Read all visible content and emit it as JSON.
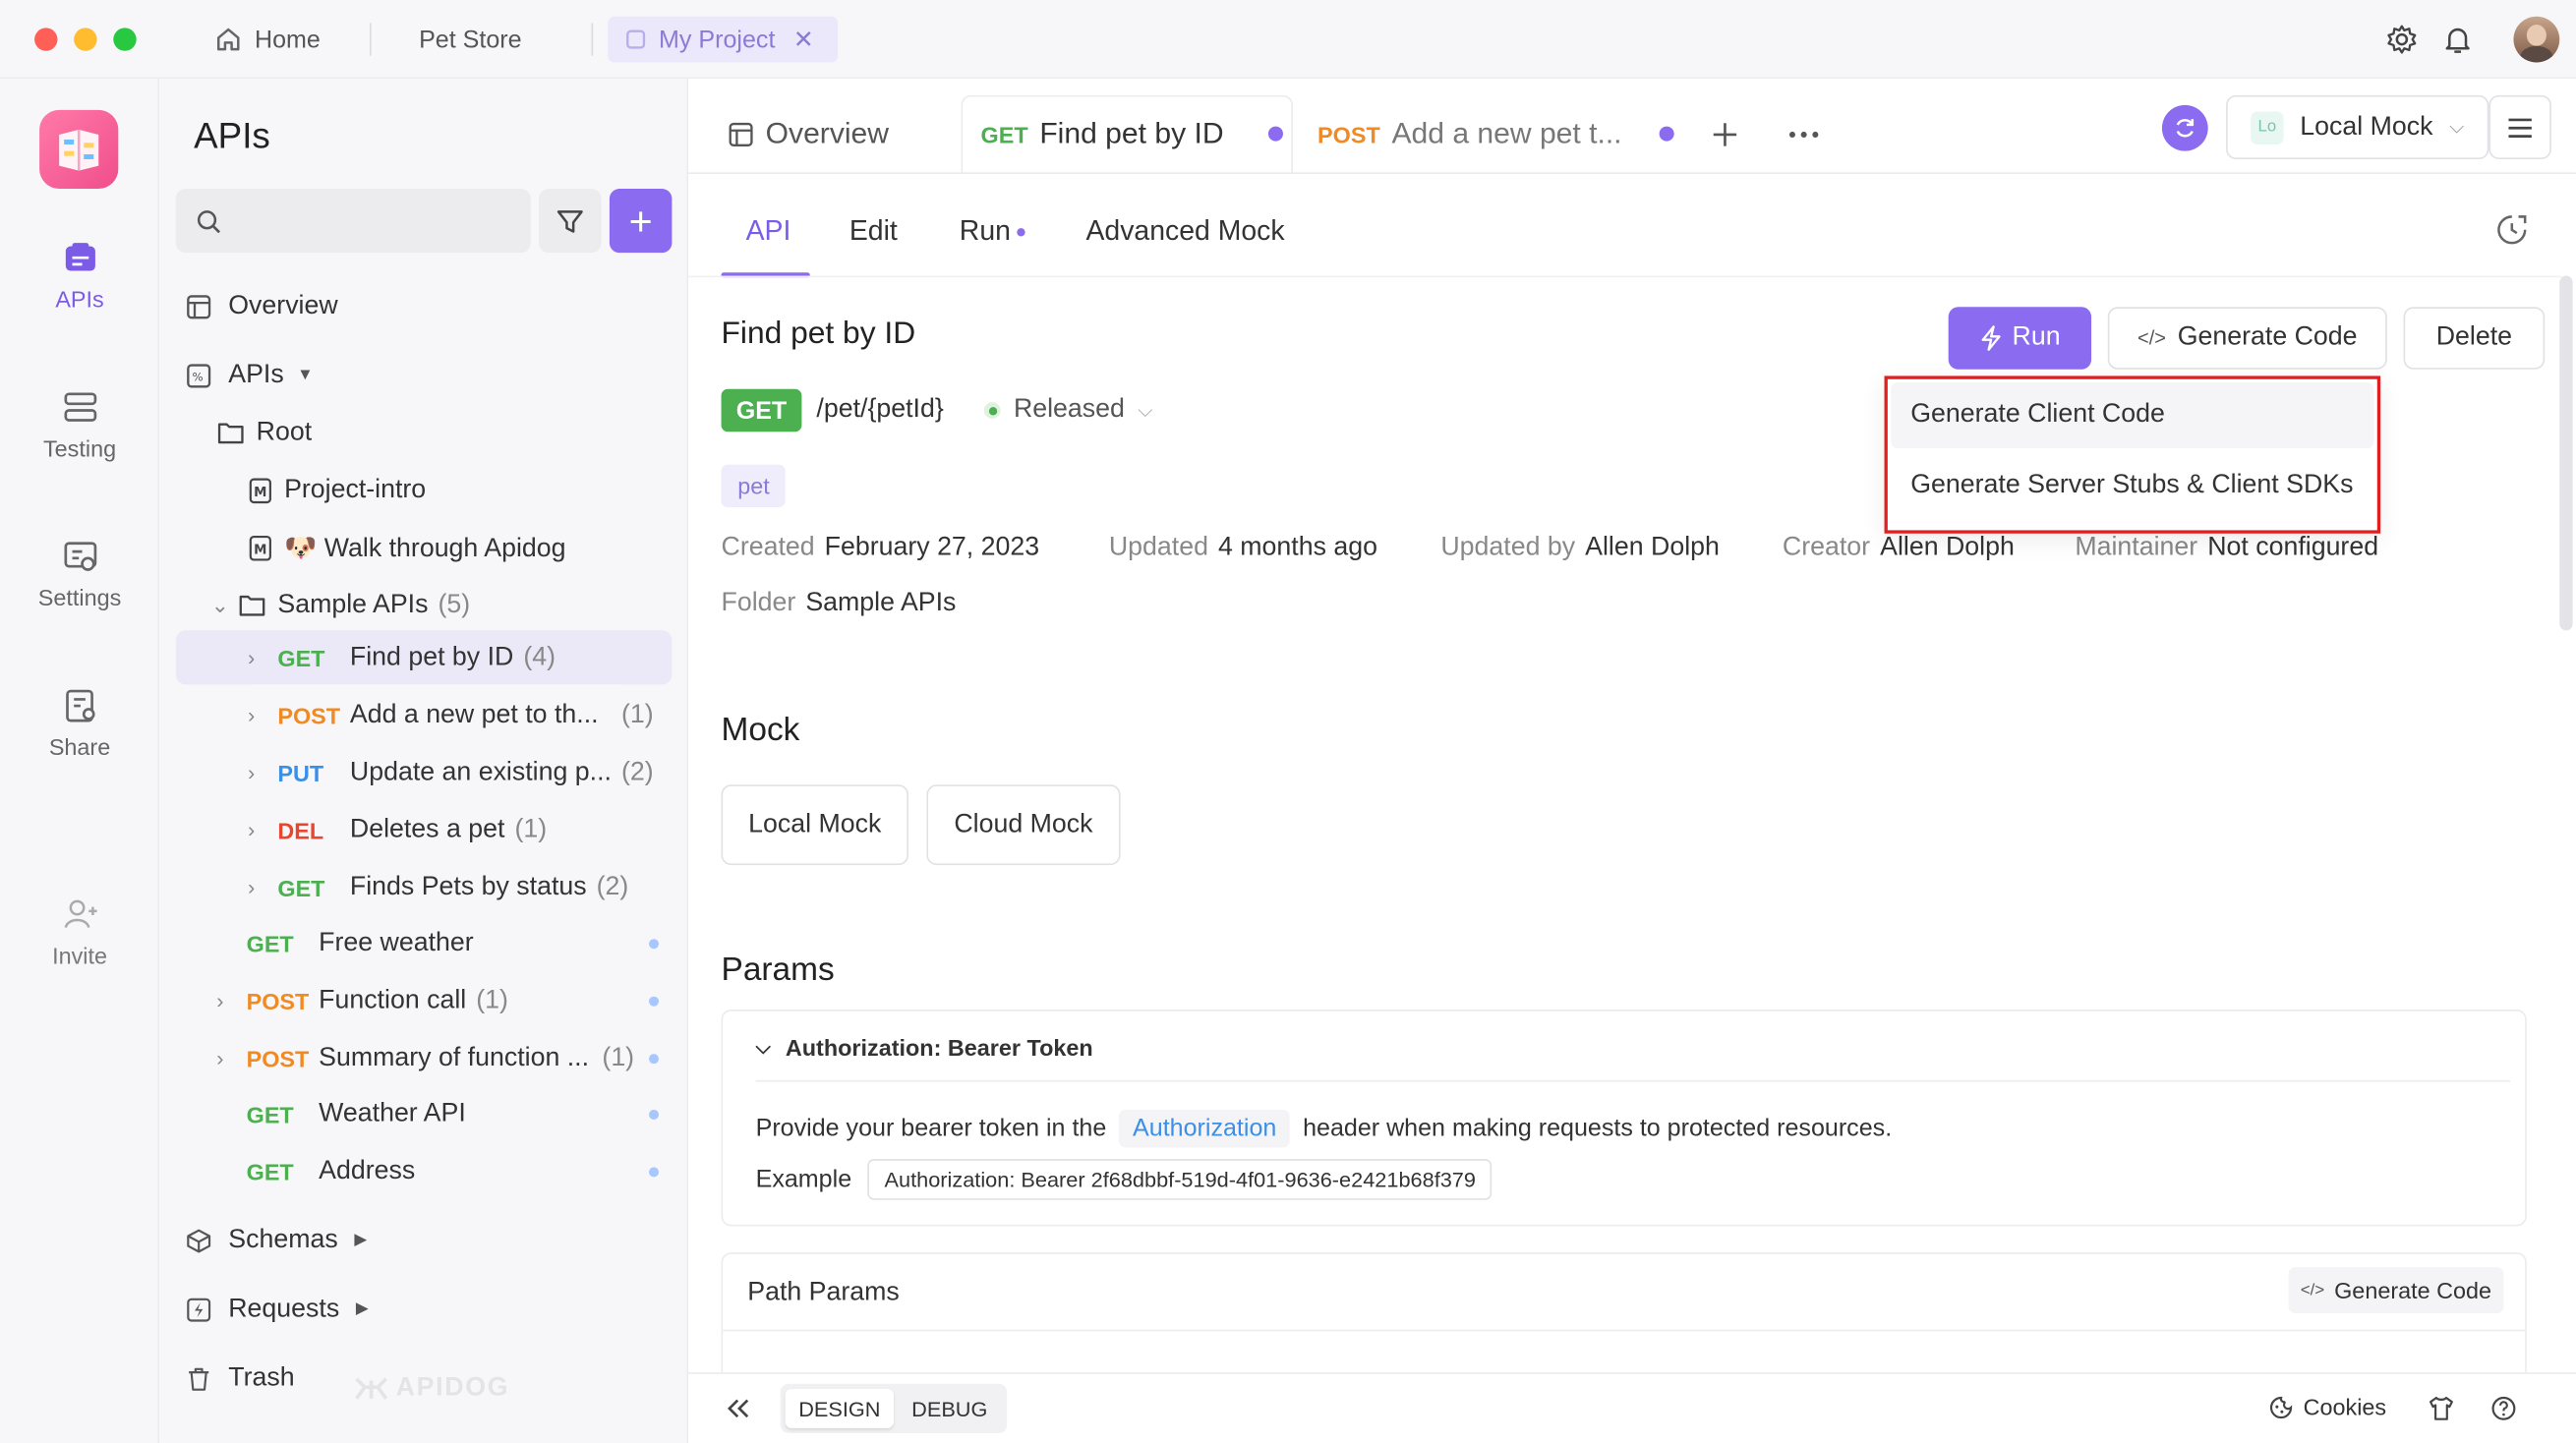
{
  "window": {
    "tabs": [
      {
        "label": "Home"
      },
      {
        "label": "Pet Store"
      },
      {
        "label": "My Project"
      }
    ]
  },
  "rail": {
    "items": [
      {
        "label": "APIs"
      },
      {
        "label": "Testing"
      },
      {
        "label": "Settings"
      },
      {
        "label": "Share"
      },
      {
        "label": "Invite"
      }
    ]
  },
  "sidebar": {
    "title": "APIs",
    "search_placeholder": "",
    "overview": "Overview",
    "apis": "APIs",
    "root": "Root",
    "docs": [
      "Project-intro",
      "🐶 Walk through Apidog"
    ],
    "folder": {
      "name": "Sample APIs",
      "count": "(5)"
    },
    "endpoints": [
      {
        "method": "GET",
        "name": "Find pet by ID",
        "count": "(4)"
      },
      {
        "method": "POST",
        "name": "Add a new pet to th...",
        "count": "(1)"
      },
      {
        "method": "PUT",
        "name": "Update an existing p...",
        "count": "(2)"
      },
      {
        "method": "DEL",
        "name": "Deletes a pet",
        "count": "(1)"
      },
      {
        "method": "GET",
        "name": "Finds Pets by status",
        "count": "(2)"
      }
    ],
    "root_endpoints": [
      {
        "method": "GET",
        "name": "Free weather",
        "count": ""
      },
      {
        "method": "POST",
        "name": "Function call",
        "count": "(1)"
      },
      {
        "method": "POST",
        "name": "Summary of function ...",
        "count": "(1)"
      },
      {
        "method": "GET",
        "name": "Weather API",
        "count": ""
      },
      {
        "method": "GET",
        "name": "Address",
        "count": ""
      }
    ],
    "schemas": "Schemas",
    "requests": "Requests",
    "trash": "Trash",
    "watermark": "APIDOG"
  },
  "doc_tabs": {
    "overview": "Overview",
    "tab1": {
      "method": "GET",
      "title": "Find pet by ID"
    },
    "tab2": {
      "method": "POST",
      "title": "Add a new pet t..."
    }
  },
  "env": {
    "badge": "Lo",
    "label": "Local Mock"
  },
  "sub_tabs": [
    "API",
    "Edit",
    "Run",
    "Advanced Mock"
  ],
  "endpoint": {
    "title": "Find pet by ID",
    "method": "GET",
    "path": "/pet/{petId}",
    "status": "Released",
    "tag": "pet",
    "created_label": "Created",
    "created": "February 27, 2023",
    "updated_label": "Updated",
    "updated": "4 months ago",
    "updated_by_label": "Updated by",
    "updated_by": "Allen Dolph",
    "creator_label": "Creator",
    "creator": "Allen Dolph",
    "maintainer_label": "Maintainer",
    "maintainer": "Not configured",
    "folder_label": "Folder",
    "folder": "Sample APIs"
  },
  "actions": {
    "run": "Run",
    "generate_code": "Generate Code",
    "delete": "Delete"
  },
  "dropdown": {
    "items": [
      "Generate Client Code",
      "Generate Server Stubs & Client SDKs"
    ],
    "highlight_color": "#e02020"
  },
  "mock": {
    "title": "Mock",
    "local": "Local Mock",
    "cloud": "Cloud Mock"
  },
  "params": {
    "title": "Params",
    "auth_title": "Authorization: Bearer Token",
    "desc_before": "Provide your bearer token in the",
    "desc_code": "Authorization",
    "desc_after": "header when making requests to protected resources.",
    "example_label": "Example",
    "example_value": "Authorization: Bearer 2f68dbbf-519d-4f01-9636-e2421b68f379",
    "path_params": "Path Params",
    "generate_code": "Generate Code"
  },
  "status_bar": {
    "design": "DESIGN",
    "debug": "DEBUG",
    "cookies": "Cookies"
  },
  "colors": {
    "accent": "#8b6cf0",
    "get": "#4caf50",
    "post": "#f08a24",
    "put": "#3b8fe6",
    "del": "#e5482e"
  }
}
